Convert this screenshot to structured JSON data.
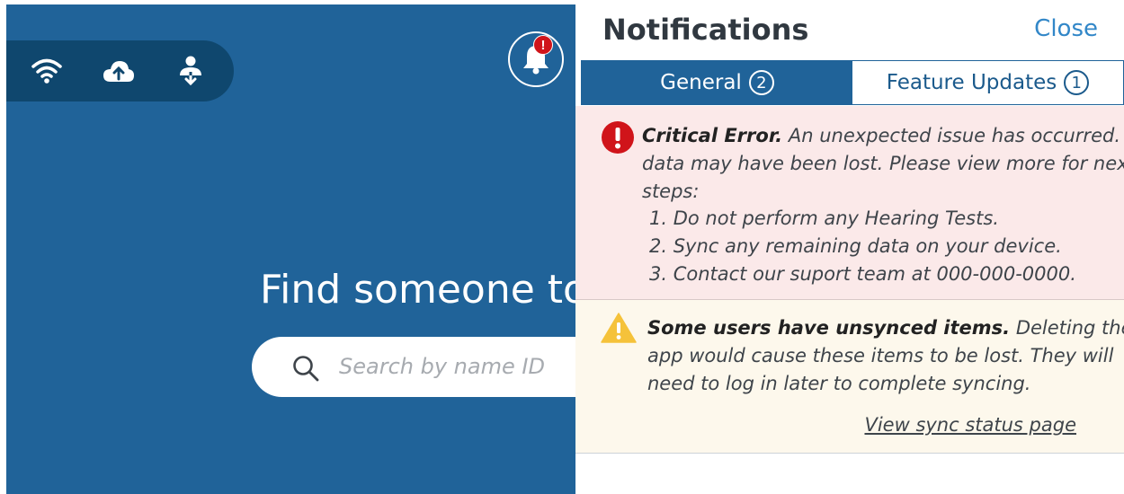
{
  "topbar": {
    "icons": [
      "wifi-icon",
      "cloud-upload-icon",
      "user-sync-icon"
    ],
    "bell_badge": "!"
  },
  "main": {
    "headline": "Find someone to",
    "search": {
      "placeholder": "Search by name ID"
    }
  },
  "panel": {
    "title": "Notifications",
    "close_label": "Close",
    "tabs": [
      {
        "label": "General",
        "count": "2",
        "active": true
      },
      {
        "label": "Feature Updates",
        "count": "1",
        "active": false
      }
    ],
    "error": {
      "title": "Critical Error.",
      "line1": "An unexpected issue has occurred. Your",
      "line2": "data may have been lost. Please view more for next",
      "line3": "steps:",
      "steps": [
        "1. Do not perform any Hearing Tests.",
        "2. Sync any remaining data on your device.",
        "3. Contact our suport team at 000-000-0000."
      ]
    },
    "warning": {
      "title": "Some users have unsynced items.",
      "line1": "Deleting the",
      "line2": "app would cause these items to be lost. They will",
      "line3": "need to log in later to complete syncing.",
      "link": "View sync status page"
    }
  },
  "colors": {
    "background_blue": "#206399",
    "pill_dark": "#0f476e",
    "error_bg": "#fbe9e9",
    "warning_bg": "#fdf8ec",
    "accent_link": "#3287c8",
    "error_red": "#d0141a",
    "warning_yellow": "#f5c23a"
  }
}
